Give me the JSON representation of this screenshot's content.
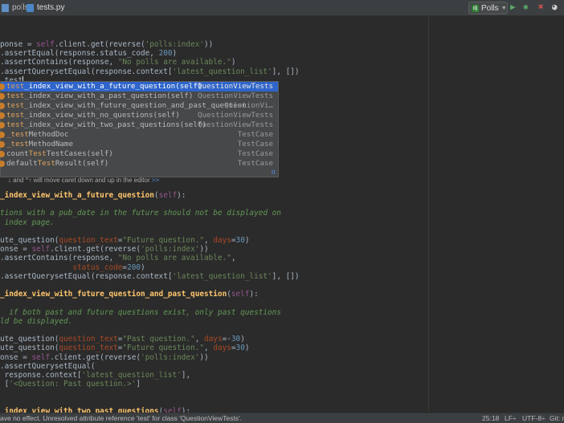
{
  "tabs": [
    {
      "label": "polls",
      "active": false
    },
    {
      "label": "tests.py",
      "active": true
    }
  ],
  "toolbar": {
    "run_config": "Polls",
    "run_icon": "play-icon",
    "debug_icon": "bug-icon",
    "coverage_icon": "coverage-icon"
  },
  "code_lines": [
    {
      "y": 0,
      "html": "ponse = <span class='self'>self</span>.client.get(reverse(<span class='str'>'polls:index'</span>))"
    },
    {
      "y": 1,
      "html": ".assertEqual(response.status_code, <span class='num'>200</span>)"
    },
    {
      "y": 2,
      "html": ".assertContains(response, <span class='str'>\"No polls are available.\"</span>)"
    },
    {
      "y": 3,
      "html": ".assertQuerysetEqual(response.context[<span class='str'>'latest_question_list'</span>], [])"
    },
    {
      "y": 4,
      "html": ".test"
    }
  ],
  "code_lines_lower": [
    {
      "y": 0,
      "html": "_index_view_with_a_future_question(<span class='self'>self</span>):",
      "def": true
    },
    {
      "y": 2,
      "html": "tions with a pub_date in the future should not be displayed on",
      "doc": true
    },
    {
      "y": 3,
      "html": " index page.",
      "doc": true
    },
    {
      "y": 5,
      "html": "ute_question(<span class='param'>question_text</span>=<span class='str'>\"Future question.\"</span>, <span class='param'>days</span>=<span class='num'>30</span>)"
    },
    {
      "y": 6,
      "html": "onse = <span class='self'>self</span>.client.get(reverse(<span class='str'>'polls:index'</span>))"
    },
    {
      "y": 7,
      "html": ".assertContains(response, <span class='str'>\"No polls are available.\"</span>,"
    },
    {
      "y": 8,
      "html": "                <span class='param'>status_code</span>=<span class='num'>200</span>)"
    },
    {
      "y": 9,
      "html": ".assertQuerysetEqual(response.context[<span class='str'>'latest_question_list'</span>], [])"
    },
    {
      "y": 11,
      "html": "_index_view_with_future_question_and_past_question(<span class='self'>self</span>):",
      "def": true
    },
    {
      "y": 13,
      "html": "  if both past and future questions exist, only past questions",
      "doc": true
    },
    {
      "y": 14,
      "html": "ld be displayed.",
      "doc": true
    },
    {
      "y": 16,
      "html": "ute_question(<span class='param'>question_text</span>=<span class='str'>\"Past question.\"</span>, <span class='param'>days</span>=-<span class='num'>30</span>)"
    },
    {
      "y": 17,
      "html": "ute_question(<span class='param'>question_text</span>=<span class='str'>\"Future question.\"</span>, <span class='param'>days</span>=<span class='num'>30</span>)"
    },
    {
      "y": 18,
      "html": "onse = <span class='self'>self</span>.client.get(reverse(<span class='str'>'polls:index'</span>))"
    },
    {
      "y": 19,
      "html": ".assertQuerysetEqual("
    },
    {
      "y": 20,
      "html": " response.context[<span class='str'>'latest_question_list'</span>],"
    },
    {
      "y": 21,
      "html": " [<span class='str'>'&lt;Question: Past question.&gt;'</span>]"
    },
    {
      "y": 24,
      "html": "_index_view_with_two_past_questions(<span class='self'>self</span>):",
      "def": true
    }
  ],
  "completion": {
    "items": [
      {
        "prefix": "test",
        "rest": "_index_view_with_a_future_question(self)",
        "type": "QuestionViewTests",
        "selected": true
      },
      {
        "prefix": "test",
        "rest": "_index_view_with_a_past_question(self)",
        "type": "QuestionViewTests"
      },
      {
        "prefix": "test",
        "rest": "_index_view_with_future_question_and_past_question",
        "type": "QuestionVi…"
      },
      {
        "prefix": "test",
        "rest": "_index_view_with_no_questions(self)",
        "type": "QuestionViewTests"
      },
      {
        "prefix": "test",
        "rest": "_index_view_with_two_past_questions(self)",
        "type": "QuestionViewTests"
      },
      {
        "prefix": "_test",
        "rest": "MethodDoc",
        "type": "TestCase"
      },
      {
        "prefix": "_test",
        "rest": "MethodName",
        "type": "TestCase"
      },
      {
        "prefix": "count",
        "rest": "TestCases(self)",
        "type": "TestCase",
        "mid": "Test"
      },
      {
        "prefix": "default",
        "rest": "Result(self)",
        "type": "TestCase",
        "mid": "Test"
      }
    ],
    "hint": "↓ and ^↑ will move caret down and up in the editor",
    "hint_link": ">>",
    "hint_pi": "π"
  },
  "status": {
    "message": "ave no effect. Unresolved attribute reference 'test' for class 'QuestionViewTests'.",
    "position": "25:18",
    "line_sep": "LF÷",
    "encoding": "UTF-8÷",
    "vcs": "Git: m"
  }
}
